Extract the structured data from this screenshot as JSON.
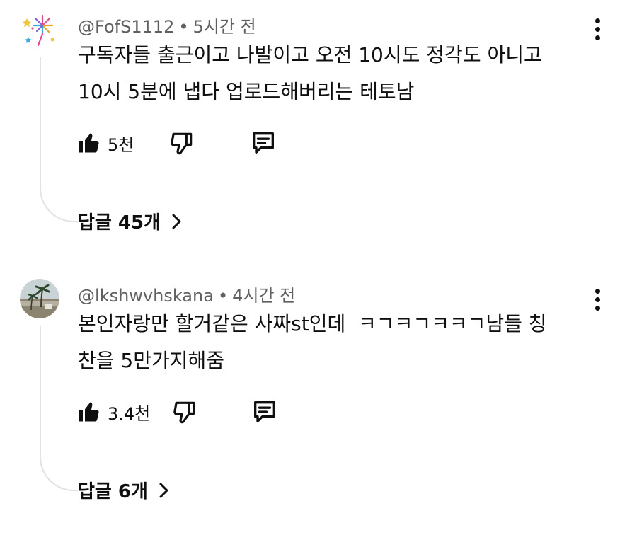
{
  "comments": [
    {
      "handle": "@FofS1112",
      "separator": "•",
      "time": "5시간 전",
      "text_line1": "구독자들 출근이고 나발이고 오전 10시도 정각도 아니고",
      "text_line2": "10시 5분에 냅다 업로드해버리는 테토남",
      "like_count": "5천",
      "replies_label": "답글 45개",
      "avatar_icon": "fireworks-icon"
    },
    {
      "handle": "@lkshwvhskana",
      "separator": "•",
      "time": "4시간 전",
      "text_line1": "본인자랑만 할거같은 사짜st인데  ㅋㄱㅋㄱㅋㅋㄱ남들 칭",
      "text_line2": "찬을 5만가지해줌",
      "like_count": "3.4천",
      "replies_label": "답글 6개",
      "avatar_icon": "beach-palm-photo"
    }
  ],
  "icons": {
    "like": "thumbs-up-icon",
    "dislike": "thumbs-down-icon",
    "reply": "comment-icon",
    "more": "more-vertical-icon",
    "chevron": "chevron-right-icon"
  }
}
